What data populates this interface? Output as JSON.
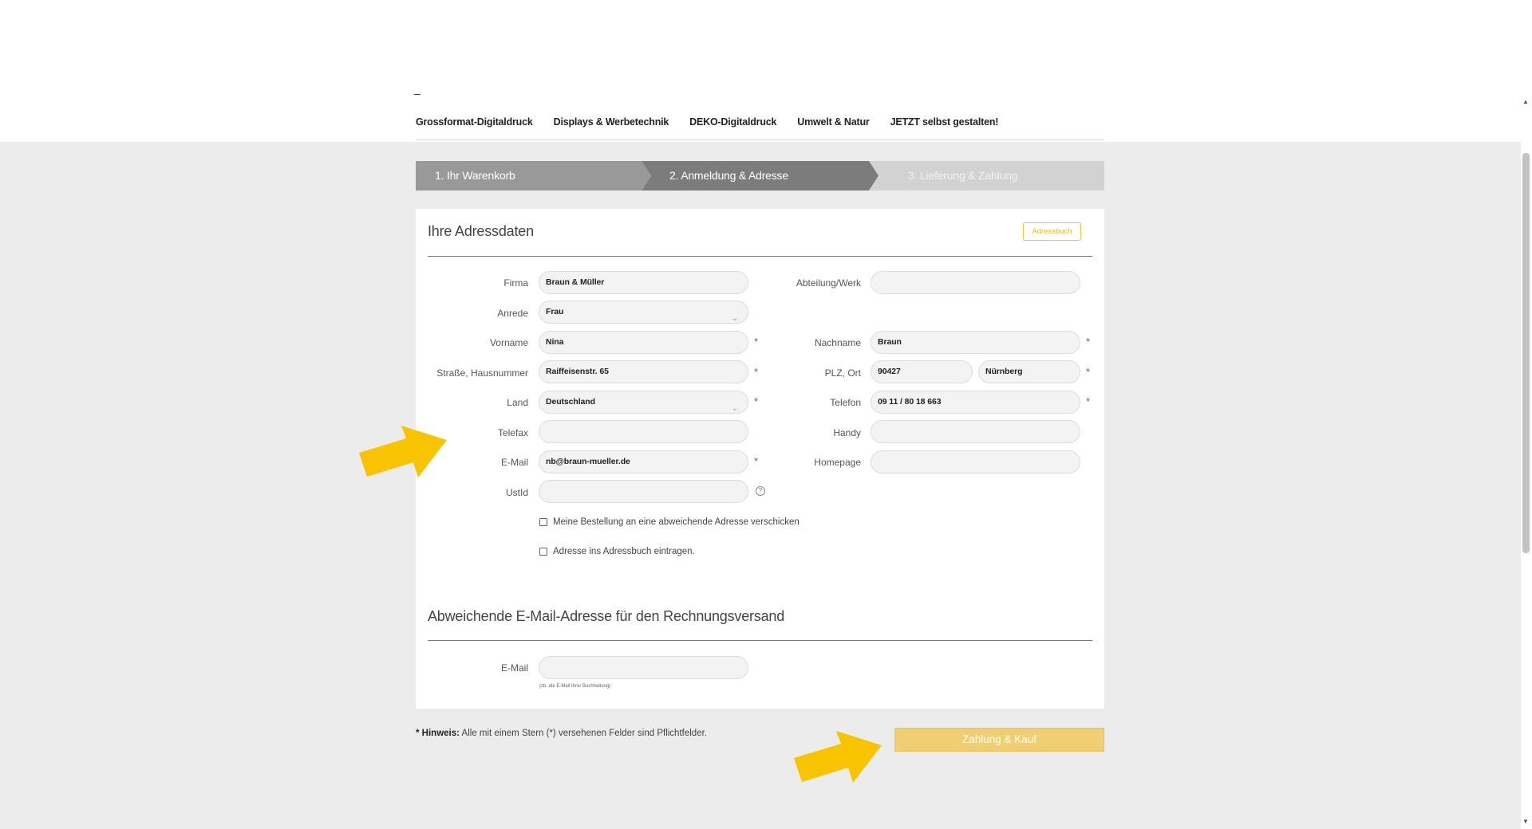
{
  "nav": {
    "items": [
      "Grossformat-Digitaldruck",
      "Displays & Werbetechnik",
      "DEKO-Digitaldruck",
      "Umwelt & Natur",
      "JETZT selbst gestalten!"
    ]
  },
  "steps": [
    {
      "label": "1. Ihr Warenkorb",
      "state": "done"
    },
    {
      "label": "2. Anmeldung & Adresse",
      "state": "active"
    },
    {
      "label": "3. Lieferung & Zahlung",
      "state": "upcoming"
    }
  ],
  "address": {
    "title": "Ihre Adressdaten",
    "addressbook_button": "Adressbuch",
    "labels": {
      "firma": "Firma",
      "abteilung": "Abteilung/Werk",
      "anrede": "Anrede",
      "vorname": "Vorname",
      "nachname": "Nachname",
      "strasse": "Straße, Hausnummer",
      "plz_ort": "PLZ, Ort",
      "land": "Land",
      "telefon": "Telefon",
      "telefax": "Telefax",
      "handy": "Handy",
      "email": "E-Mail",
      "homepage": "Homepage",
      "ustid": "UstId"
    },
    "values": {
      "firma": "Braun & Müller",
      "abteilung": "",
      "anrede": "Frau",
      "vorname": "Nina",
      "nachname": "Braun",
      "strasse": "Raiffeisenstr. 65",
      "plz": "90427",
      "ort": "Nürnberg",
      "land": "Deutschland",
      "telefon": "09 11 / 80 18 663",
      "telefax": "",
      "handy": "",
      "email": "nb@braun-mueller.de",
      "homepage": "",
      "ustid": ""
    },
    "required_mark": "*",
    "help_glyph": "?",
    "checkbox_other_address": "Meine Bestellung an eine abweichende Adresse verschicken",
    "checkbox_addressbook": "Adresse ins Adressbuch eintragen."
  },
  "invoice_email": {
    "title": "Abweichende E-Mail-Adresse für den Rechnungsversand",
    "label": "E-Mail",
    "value": "",
    "note": "(zb. die E-Mail Ihrer Buchhaltung)"
  },
  "hint": {
    "bold": "* Hinweis:",
    "text": " Alle mit einem Stern (*) versehenen Felder sind Pflichtfelder."
  },
  "pay_button": "Zahlung & Kauf",
  "icons": {
    "chevron": "chevron-down-icon",
    "arrow_color": "#f8c400"
  }
}
